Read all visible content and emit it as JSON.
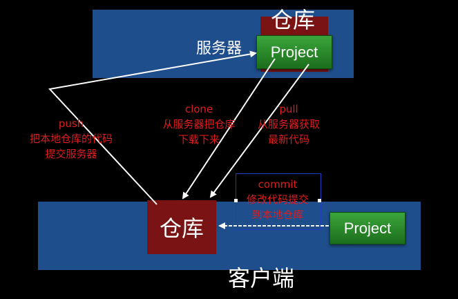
{
  "server": {
    "repo_label": "仓库",
    "server_label": "服务器",
    "project_label": "Project"
  },
  "client": {
    "repo_label": "仓库",
    "project_label": "Project",
    "client_label": "客户端"
  },
  "annotations": {
    "push": {
      "title": "push",
      "line1": "把本地仓库的代码",
      "line2": "提交服务器"
    },
    "clone": {
      "title": "clone",
      "line1": "从服务器把仓库",
      "line2": "下载下来"
    },
    "pull": {
      "title": "pull",
      "line1": "从服务器获取",
      "line2": "最新代码"
    },
    "commit": {
      "title": "commit",
      "line1": "修改代码提交",
      "line2": "到本地仓库"
    }
  }
}
